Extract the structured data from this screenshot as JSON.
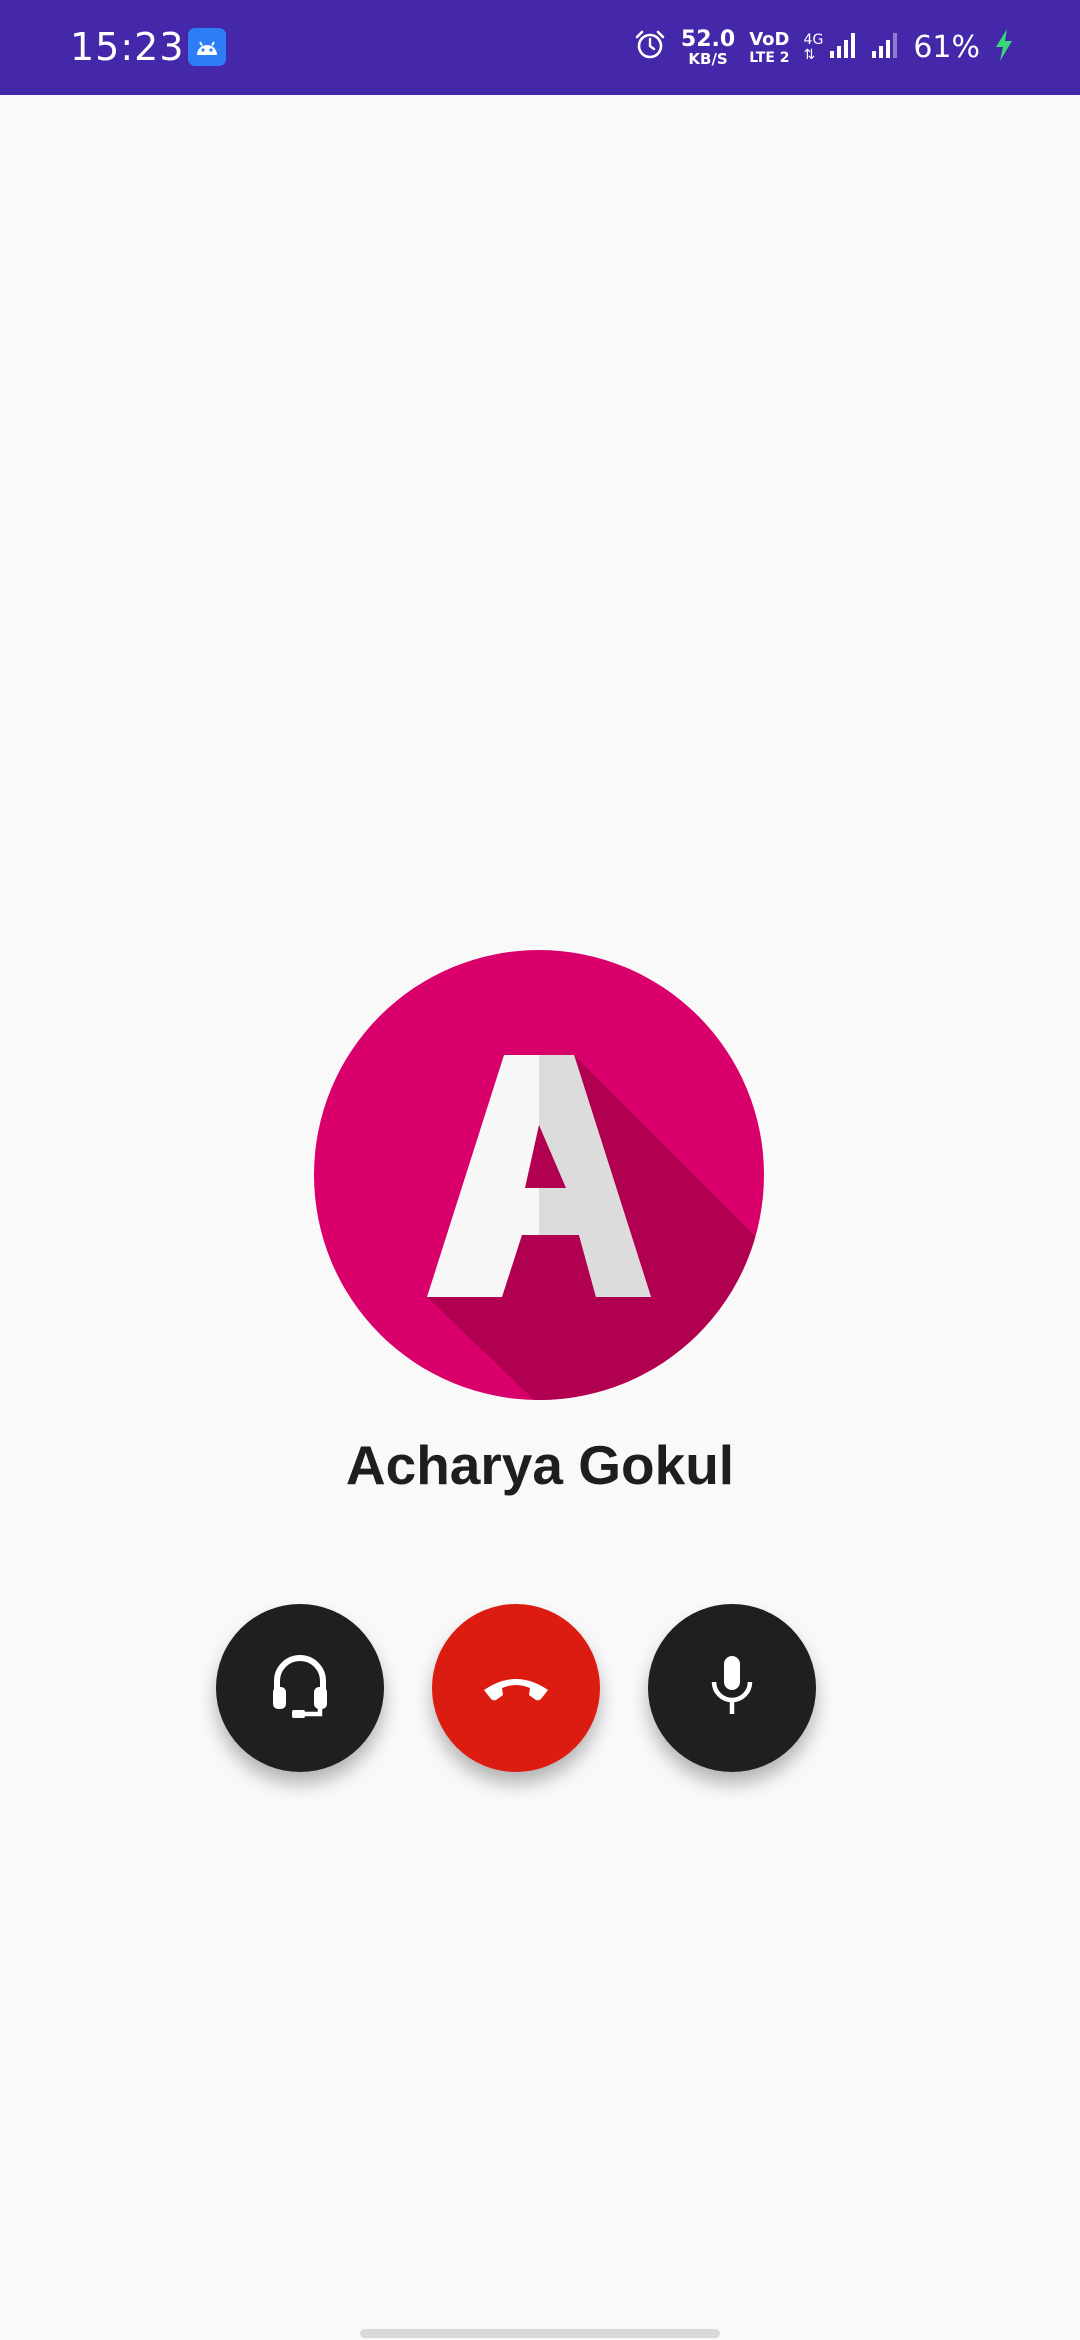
{
  "status_bar": {
    "time": "15:23",
    "network_speed_value": "52.0",
    "network_speed_unit": "KB/S",
    "volte_line1": "VoD",
    "volte_line2": "LTE 2",
    "network_type": "4G",
    "battery_percent": "61%",
    "colors": {
      "background": "#4527a9",
      "app_icon": "#2d7df6",
      "charging": "#39d97a"
    }
  },
  "contact": {
    "name": "Acharya Gokul",
    "avatar_letter": "A",
    "avatar_color": "#d9006b"
  },
  "controls": {
    "headset": {
      "icon": "headset-icon"
    },
    "end_call": {
      "icon": "end-call-icon",
      "color": "#dd1c11"
    },
    "microphone": {
      "icon": "microphone-icon"
    }
  }
}
